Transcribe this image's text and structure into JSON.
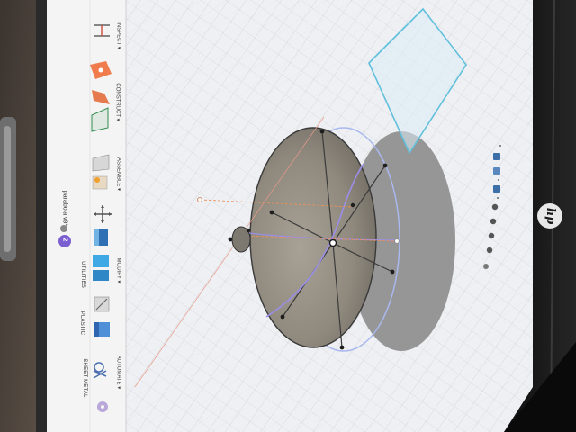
{
  "document": {
    "title": "parabola v9*",
    "version_badge": "2"
  },
  "toolbar": {
    "tabs": [
      {
        "id": "sheet-metal",
        "label": "SHEET METAL"
      },
      {
        "id": "plastic",
        "label": "PLASTIC"
      },
      {
        "id": "utilities",
        "label": "UTILITIES"
      }
    ],
    "groups": [
      {
        "id": "automate",
        "label": "AUTOMATE ▾"
      },
      {
        "id": "modify",
        "label": "MODIFY ▾"
      },
      {
        "id": "assemble",
        "label": "ASSEMBLE ▾"
      },
      {
        "id": "construct",
        "label": "CONSTRUCT ▾"
      },
      {
        "id": "inspect",
        "label": "INSPECT ▾"
      }
    ]
  },
  "laptop": {
    "brand": "hp"
  },
  "colors": {
    "canvas": "#eef0f3",
    "toolbar": "#f3f3f3",
    "dish_face": "#918b80",
    "dish_shadow": "#8a8a8a",
    "plane_outline": "#62c0dc",
    "sketch_curve": "#9b8ee6",
    "construction_line": "#e8915a",
    "bezel": "#1c1c1c"
  }
}
